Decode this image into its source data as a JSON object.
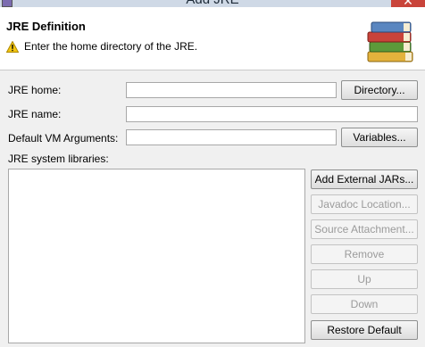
{
  "window": {
    "title": "Add JRE",
    "close_glyph": "✕"
  },
  "header": {
    "heading": "JRE Definition",
    "message": "Enter the home directory of the JRE.",
    "message_icon": "warning-icon",
    "banner_icon": "books-icon"
  },
  "form": {
    "jre_home_label": "JRE home:",
    "jre_home_value": "",
    "jre_name_label": "JRE name:",
    "jre_name_value": "",
    "vm_args_label": "Default VM Arguments:",
    "vm_args_value": "",
    "libraries_label": "JRE system libraries:"
  },
  "buttons": {
    "directory": "Directory...",
    "variables": "Variables...",
    "add_external_jars": "Add External JARs...",
    "javadoc_location": "Javadoc Location...",
    "source_attachment": "Source Attachment...",
    "remove": "Remove",
    "up": "Up",
    "down": "Down",
    "restore_default": "Restore Default"
  },
  "colors": {
    "warning": "#f2c511",
    "close": "#c9443a"
  }
}
